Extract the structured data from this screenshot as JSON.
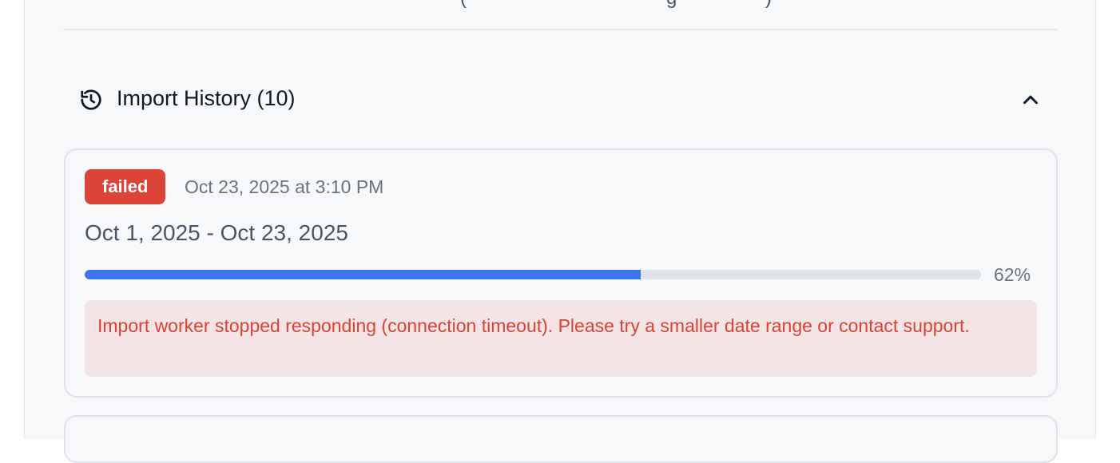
{
  "history": {
    "title": "Import History (10)",
    "icon": "history-icon",
    "collapse_icon": "chevron-up-icon"
  },
  "imports": [
    {
      "status": "failed",
      "status_color": "#dc4437",
      "timestamp": "Oct 23, 2025 at 3:10 PM",
      "date_range": "Oct 1, 2025 - Oct 23, 2025",
      "progress": 62,
      "progress_label": "62%",
      "progress_color": "#3b74e8",
      "error": "Import worker stopped responding (connection timeout). Please try a smaller date range or contact support."
    }
  ]
}
